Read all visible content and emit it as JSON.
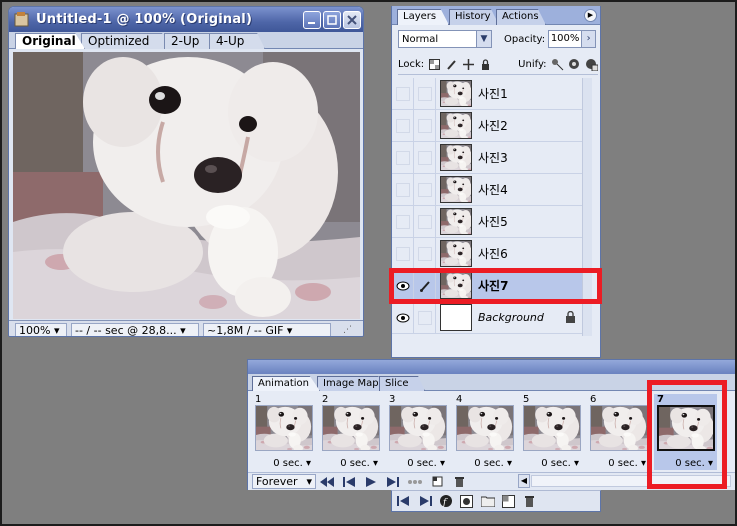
{
  "doc_window": {
    "title": "Untitled-1 @ 100% (Original)",
    "tabs": [
      "Original",
      "Optimized",
      "2-Up",
      "4-Up"
    ],
    "active_tab": "Original",
    "status": {
      "zoom": "100%",
      "time": "-- / -- sec @ 28,8...",
      "size": "~1,8M / -- GIF"
    }
  },
  "layers_panel": {
    "tabs": [
      "Layers",
      "History",
      "Actions"
    ],
    "active_tab": "Layers",
    "blend_mode": "Normal",
    "opacity_label": "Opacity:",
    "opacity_value": "100%",
    "lock_label": "Lock:",
    "unify_label": "Unify:",
    "layers": [
      {
        "name": "사진1",
        "visible": false,
        "selected": false
      },
      {
        "name": "사진2",
        "visible": false,
        "selected": false
      },
      {
        "name": "사진3",
        "visible": false,
        "selected": false
      },
      {
        "name": "사진4",
        "visible": false,
        "selected": false
      },
      {
        "name": "사진5",
        "visible": false,
        "selected": false
      },
      {
        "name": "사진6",
        "visible": false,
        "selected": false
      },
      {
        "name": "사진7",
        "visible": true,
        "selected": true
      },
      {
        "name": "Background",
        "visible": true,
        "selected": false,
        "locked": true
      }
    ]
  },
  "animation_panel": {
    "tabs": [
      "Animation",
      "Image Map",
      "Slice"
    ],
    "active_tab": "Animation",
    "frames": [
      {
        "number": "1",
        "delay": "0 sec."
      },
      {
        "number": "2",
        "delay": "0 sec."
      },
      {
        "number": "3",
        "delay": "0 sec."
      },
      {
        "number": "4",
        "delay": "0 sec."
      },
      {
        "number": "5",
        "delay": "0 sec."
      },
      {
        "number": "6",
        "delay": "0 sec."
      },
      {
        "number": "7",
        "delay": "0 sec.",
        "selected": true
      }
    ],
    "loop": "Forever"
  },
  "colors": {
    "title_blue": "#4e66a8",
    "panel_bg": "#e6ebf5",
    "selection": "#b8c7ea",
    "highlight_red": "#ec1c24",
    "desktop": "#7f7f7f"
  }
}
